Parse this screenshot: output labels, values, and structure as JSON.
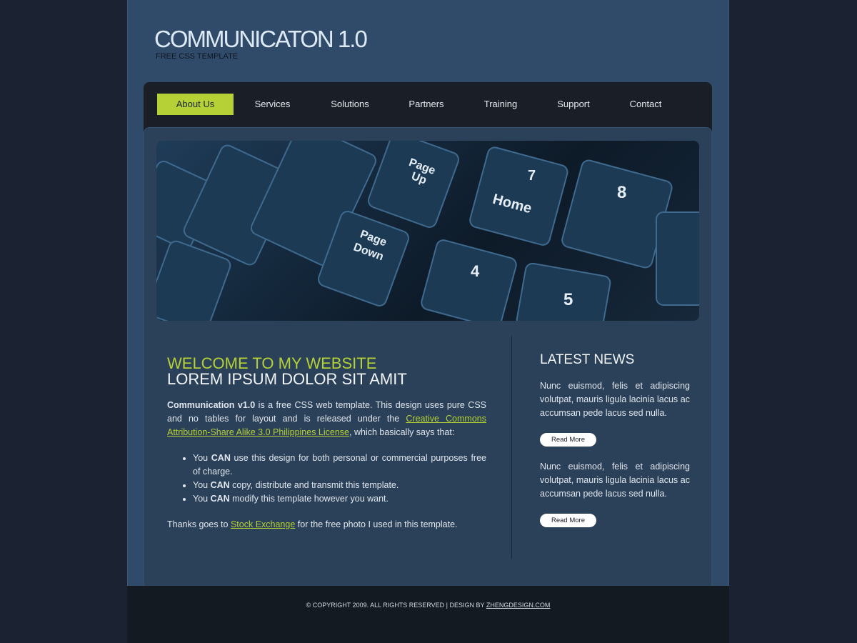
{
  "header": {
    "title": "COMMUNICATON 1.0",
    "subtitle": "FREE CSS TEMPLATE"
  },
  "nav": {
    "items": [
      {
        "label": "About Us",
        "active": true
      },
      {
        "label": "Services"
      },
      {
        "label": "Solutions"
      },
      {
        "label": "Partners"
      },
      {
        "label": "Training"
      },
      {
        "label": "Support"
      },
      {
        "label": "Contact"
      }
    ]
  },
  "banner": {
    "keys": [
      "Page Up",
      "Home",
      "Page Down",
      "7",
      "8",
      "4",
      "5"
    ]
  },
  "main": {
    "heading1": "WELCOME TO MY WEBSITE",
    "heading2": "LOREM IPSUM DOLOR SIT AMIT",
    "intro_bold": "Communication v1.0",
    "intro_text": " is a free CSS web template. This design uses pure CSS and no tables for layout and is released under the ",
    "license_link": "Creative Commons Attribution-Share Alike 3.0 Philippines License",
    "intro_end": ", which basically says that:",
    "bullets": [
      {
        "pre": "You ",
        "bold": "CAN",
        "post": " use this design for both personal or commercial purposes free of charge."
      },
      {
        "pre": "You ",
        "bold": "CAN",
        "post": " copy, distribute and transmit this template."
      },
      {
        "pre": "You ",
        "bold": "CAN",
        "post": " modify this template however you want."
      }
    ],
    "thanks_pre": "Thanks goes to ",
    "thanks_link": "Stock Exchange",
    "thanks_post": " for the free photo I used in this template."
  },
  "news": {
    "title": "LATEST NEWS",
    "items": [
      {
        "text": "Nunc euismod, felis et adipiscing volutpat, mauris ligula lacinia lacus ac accumsan pede lacus sed nulla.",
        "button": "Read More"
      },
      {
        "text": "Nunc euismod, felis et adipiscing volutpat, mauris ligula lacinia lacus ac accumsan pede lacus sed nulla.",
        "button": "Read More"
      }
    ]
  },
  "footer": {
    "text": "© COPYRIGHT 2009. ALL RIGHTS RESERVED | DESIGN BY ",
    "link": "ZHENGDESIGN.COM"
  },
  "colors": {
    "accent": "#b5d136",
    "background": "#2f4b69",
    "nav": "#1a1f27"
  }
}
